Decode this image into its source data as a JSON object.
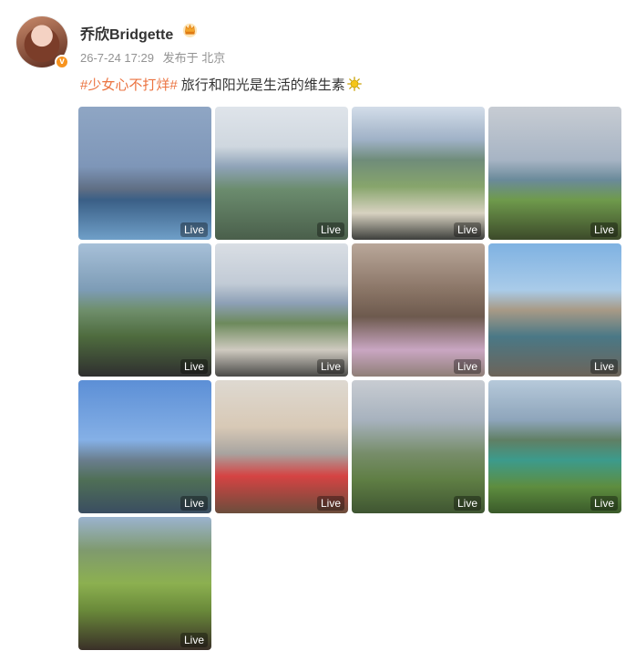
{
  "post": {
    "username": "乔欣Bridgette",
    "timestamp": "26-7-24 17:29",
    "source": "发布于 北京",
    "topic": "#少女心不打烊#",
    "text": "旅行和阳光是生活的维生素"
  },
  "icons": {
    "verified": "verified-badge-icon",
    "crown": "crown-icon",
    "sun": "sun-emoji-icon"
  },
  "colors": {
    "topic": "#eb7340",
    "meta": "#939393",
    "verified_badge": "#f7931e"
  },
  "photos": [
    {
      "badge": "Live"
    },
    {
      "badge": "Live"
    },
    {
      "badge": "Live"
    },
    {
      "badge": "Live"
    },
    {
      "badge": "Live"
    },
    {
      "badge": "Live"
    },
    {
      "badge": "Live"
    },
    {
      "badge": "Live"
    },
    {
      "badge": "Live"
    },
    {
      "badge": "Live"
    },
    {
      "badge": "Live"
    },
    {
      "badge": "Live"
    },
    {
      "badge": "Live"
    }
  ]
}
